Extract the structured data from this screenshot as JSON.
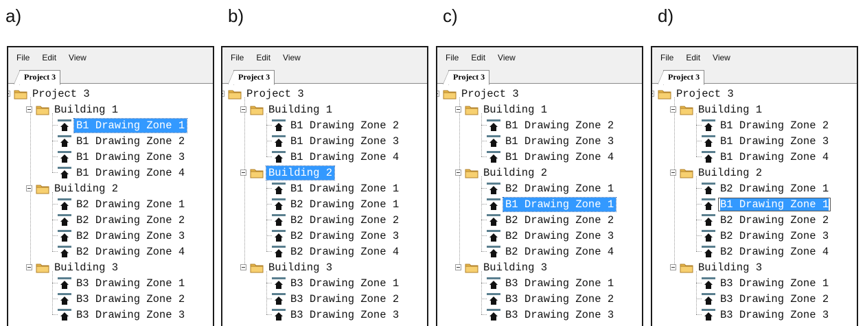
{
  "panels": [
    {
      "label": "a)",
      "menu": [
        "File",
        "Edit",
        "View"
      ],
      "tab": "Project 3",
      "tree": [
        {
          "level": 0,
          "kind": "folder",
          "text": "Project 3"
        },
        {
          "level": 1,
          "kind": "folder",
          "text": "Building 1"
        },
        {
          "level": 2,
          "kind": "zone",
          "text": "B1 Drawing Zone 1",
          "state": "selected"
        },
        {
          "level": 2,
          "kind": "zone",
          "text": "B1 Drawing Zone 2"
        },
        {
          "level": 2,
          "kind": "zone",
          "text": "B1 Drawing Zone 3"
        },
        {
          "level": 2,
          "kind": "zone",
          "text": "B1 Drawing Zone 4"
        },
        {
          "level": 1,
          "kind": "folder",
          "text": "Building 2"
        },
        {
          "level": 2,
          "kind": "zone",
          "text": "B2 Drawing Zone 1"
        },
        {
          "level": 2,
          "kind": "zone",
          "text": "B2 Drawing Zone 2"
        },
        {
          "level": 2,
          "kind": "zone",
          "text": "B2 Drawing Zone 3"
        },
        {
          "level": 2,
          "kind": "zone",
          "text": "B2 Drawing Zone 4"
        },
        {
          "level": 1,
          "kind": "folder",
          "text": "Building 3"
        },
        {
          "level": 2,
          "kind": "zone",
          "text": "B3 Drawing Zone 1"
        },
        {
          "level": 2,
          "kind": "zone",
          "text": "B3 Drawing Zone 2"
        },
        {
          "level": 2,
          "kind": "zone",
          "text": "B3 Drawing Zone 3"
        }
      ]
    },
    {
      "label": "b)",
      "menu": [
        "File",
        "Edit",
        "View"
      ],
      "tab": "Project 3",
      "tree": [
        {
          "level": 0,
          "kind": "folder",
          "text": "Project 3"
        },
        {
          "level": 1,
          "kind": "folder",
          "text": "Building 1"
        },
        {
          "level": 2,
          "kind": "zone",
          "text": "B1 Drawing Zone 2"
        },
        {
          "level": 2,
          "kind": "zone",
          "text": "B1 Drawing Zone 3"
        },
        {
          "level": 2,
          "kind": "zone",
          "text": "B1 Drawing Zone 4"
        },
        {
          "level": 1,
          "kind": "folder",
          "text": "Building 2",
          "state": "selected"
        },
        {
          "level": 2,
          "kind": "zone",
          "text": "B1 Drawing Zone 1"
        },
        {
          "level": 2,
          "kind": "zone",
          "text": "B2 Drawing Zone 1"
        },
        {
          "level": 2,
          "kind": "zone",
          "text": "B2 Drawing Zone 2"
        },
        {
          "level": 2,
          "kind": "zone",
          "text": "B2 Drawing Zone 3"
        },
        {
          "level": 2,
          "kind": "zone",
          "text": "B2 Drawing Zone 4"
        },
        {
          "level": 1,
          "kind": "folder",
          "text": "Building 3"
        },
        {
          "level": 2,
          "kind": "zone",
          "text": "B3 Drawing Zone 1"
        },
        {
          "level": 2,
          "kind": "zone",
          "text": "B3 Drawing Zone 2"
        },
        {
          "level": 2,
          "kind": "zone",
          "text": "B3 Drawing Zone 3"
        }
      ]
    },
    {
      "label": "c)",
      "menu": [
        "File",
        "Edit",
        "View"
      ],
      "tab": "Project 3",
      "tree": [
        {
          "level": 0,
          "kind": "folder",
          "text": "Project 3"
        },
        {
          "level": 1,
          "kind": "folder",
          "text": "Building 1"
        },
        {
          "level": 2,
          "kind": "zone",
          "text": "B1 Drawing Zone 2"
        },
        {
          "level": 2,
          "kind": "zone",
          "text": "B1 Drawing Zone 3"
        },
        {
          "level": 2,
          "kind": "zone",
          "text": "B1 Drawing Zone 4"
        },
        {
          "level": 1,
          "kind": "folder",
          "text": "Building 2"
        },
        {
          "level": 2,
          "kind": "zone",
          "text": "B2 Drawing Zone 1"
        },
        {
          "level": 2,
          "kind": "zone",
          "text": "B1 Drawing Zone 1",
          "state": "selected"
        },
        {
          "level": 2,
          "kind": "zone",
          "text": "B2 Drawing Zone 2"
        },
        {
          "level": 2,
          "kind": "zone",
          "text": "B2 Drawing Zone 3"
        },
        {
          "level": 2,
          "kind": "zone",
          "text": "B2 Drawing Zone 4"
        },
        {
          "level": 1,
          "kind": "folder",
          "text": "Building 3"
        },
        {
          "level": 2,
          "kind": "zone",
          "text": "B3 Drawing Zone 1"
        },
        {
          "level": 2,
          "kind": "zone",
          "text": "B3 Drawing Zone 2"
        },
        {
          "level": 2,
          "kind": "zone",
          "text": "B3 Drawing Zone 3"
        }
      ]
    },
    {
      "label": "d)",
      "menu": [
        "File",
        "Edit",
        "View"
      ],
      "tab": "Project 3",
      "tree": [
        {
          "level": 0,
          "kind": "folder",
          "text": "Project 3"
        },
        {
          "level": 1,
          "kind": "folder",
          "text": "Building 1"
        },
        {
          "level": 2,
          "kind": "zone",
          "text": "B1 Drawing Zone 2"
        },
        {
          "level": 2,
          "kind": "zone",
          "text": "B1 Drawing Zone 3"
        },
        {
          "level": 2,
          "kind": "zone",
          "text": "B1 Drawing Zone 4"
        },
        {
          "level": 1,
          "kind": "folder",
          "text": "Building 2"
        },
        {
          "level": 2,
          "kind": "zone",
          "text": "B2 Drawing Zone 1"
        },
        {
          "level": 2,
          "kind": "zone",
          "text": "B1 Drawing Zone 1",
          "state": "editing"
        },
        {
          "level": 2,
          "kind": "zone",
          "text": "B2 Drawing Zone 2"
        },
        {
          "level": 2,
          "kind": "zone",
          "text": "B2 Drawing Zone 3"
        },
        {
          "level": 2,
          "kind": "zone",
          "text": "B2 Drawing Zone 4"
        },
        {
          "level": 1,
          "kind": "folder",
          "text": "Building 3"
        },
        {
          "level": 2,
          "kind": "zone",
          "text": "B3 Drawing Zone 1"
        },
        {
          "level": 2,
          "kind": "zone",
          "text": "B3 Drawing Zone 2"
        },
        {
          "level": 2,
          "kind": "zone",
          "text": "B3 Drawing Zone 3"
        }
      ]
    }
  ]
}
